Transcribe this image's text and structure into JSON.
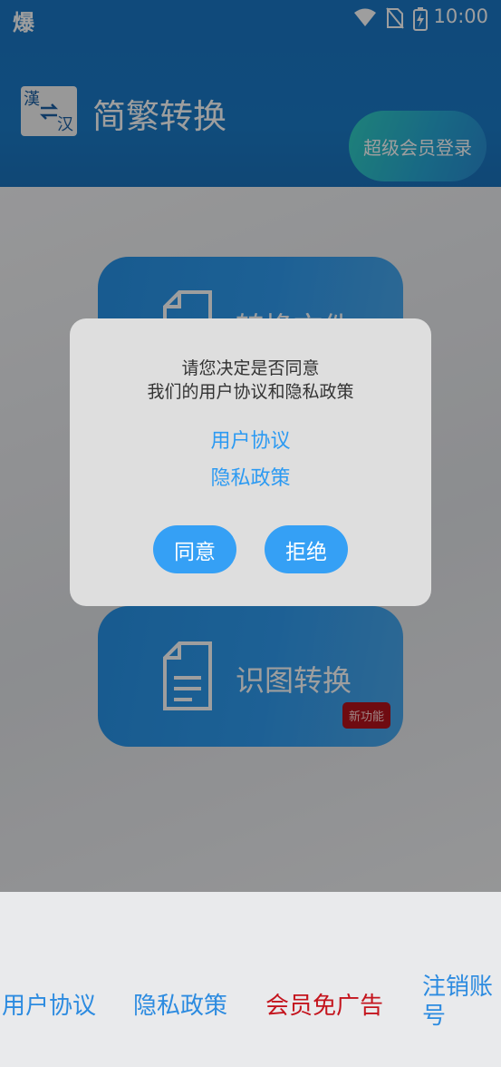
{
  "status_bar": {
    "left_glyph": "爆",
    "time": "10:00",
    "icons": [
      "wifi-icon",
      "no-sim-icon",
      "battery-charging-icon"
    ]
  },
  "header": {
    "logo": {
      "top_char": "漢",
      "bottom_char": "汉",
      "icon": "swap-arrows-icon"
    },
    "title": "简繁转换",
    "vip_login": "超级会员登录"
  },
  "main": {
    "cards": [
      {
        "label": "转换文件",
        "icon": "document-icon"
      },
      {
        "label": "识图转换",
        "icon": "document-icon",
        "badge": "新功能"
      }
    ]
  },
  "footer_links": {
    "user_agreement": "用户协议",
    "privacy_policy": "隐私政策",
    "vip_no_ads": "会员免广告",
    "cancel_account": "注销账号"
  },
  "dialog": {
    "line1": "请您决定是否同意",
    "line2": "我们的用户协议和隐私政策",
    "link_user_agreement": "用户协议",
    "link_privacy_policy": "隐私政策",
    "agree": "同意",
    "refuse": "拒绝"
  },
  "colors": {
    "primary": "#1b78c7",
    "card_blue": "#2f9cf0",
    "link_blue": "#2c9af2",
    "promo_red": "#c4141d",
    "badge_red": "#b3121c"
  }
}
